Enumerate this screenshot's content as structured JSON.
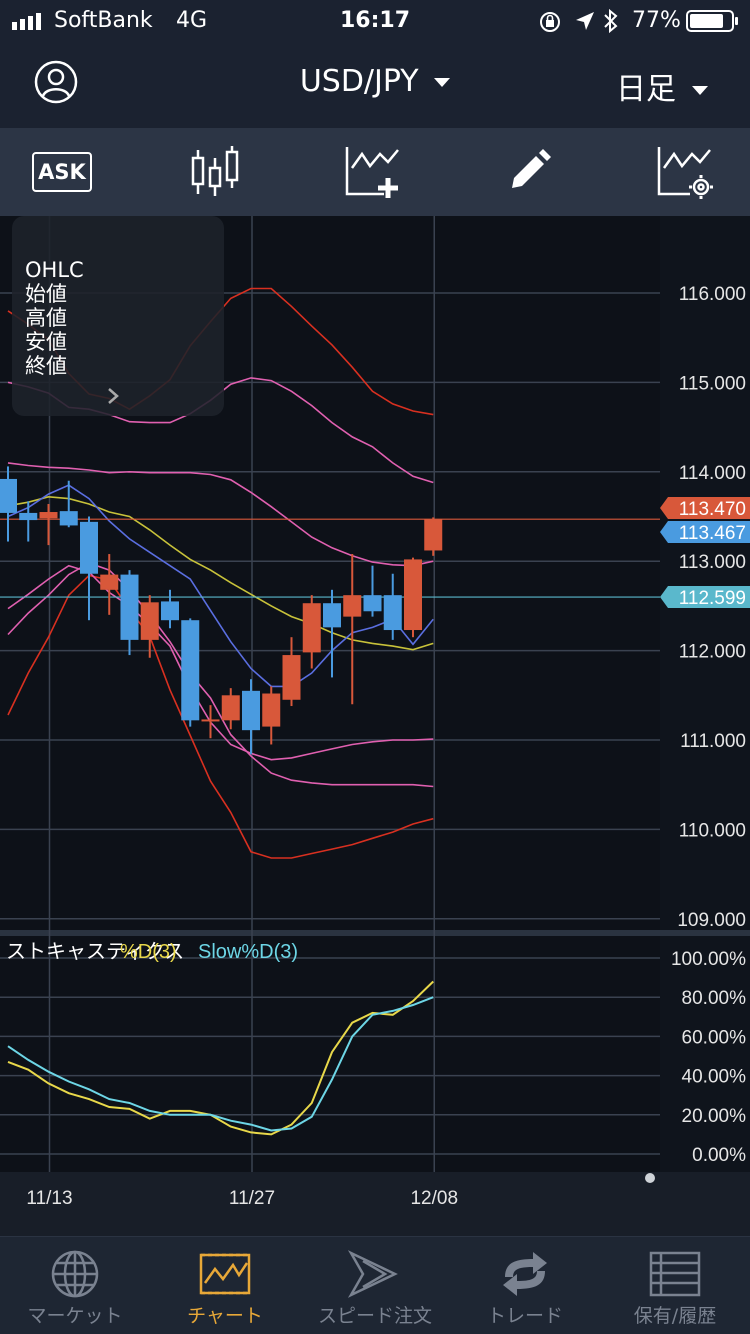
{
  "status_bar": {
    "carrier": "SoftBank",
    "network": "4G",
    "time": "16:17",
    "battery": "77%"
  },
  "header": {
    "pair": "USD/JPY",
    "timeframe": "日足"
  },
  "toolbar": {
    "ask_label": "ASK"
  },
  "ohlc_panel": {
    "title": "OHLC",
    "open": "始値",
    "high": "高値",
    "low": "安値",
    "close": "終値"
  },
  "price_axis": {
    "labels": [
      "116.000",
      "115.000",
      "114.000",
      "113.000",
      "112.000",
      "111.000",
      "110.000",
      "109.000"
    ],
    "ask_price": "113.470",
    "bid_price": "113.467",
    "line_price": "112.599"
  },
  "stoch": {
    "title": "ストキャスティクス",
    "d_label": "%D(3)",
    "slow_label": "Slow%D(3)",
    "axis_labels": [
      "100.00%",
      "80.00%",
      "60.00%",
      "40.00%",
      "20.00%",
      "0.00%"
    ]
  },
  "x_axis": {
    "labels": [
      "11/13",
      "11/27",
      "12/08"
    ]
  },
  "colors": {
    "up": "#d8583a",
    "down": "#4a9be0",
    "ma": "#c8c23a",
    "ma2": "#5a6ee0",
    "band1": "#e060b0",
    "band3": "#d83020",
    "stoch_d": "#e8d84a",
    "stoch_slow": "#6dd6e6",
    "accent": "#e8a838"
  },
  "tabs": [
    {
      "label": "マーケット",
      "icon": "globe-icon",
      "active": false
    },
    {
      "label": "チャート",
      "icon": "chart-icon",
      "active": true
    },
    {
      "label": "スピード注文",
      "icon": "speed-order-icon",
      "active": false
    },
    {
      "label": "トレード",
      "icon": "trade-icon",
      "active": false
    },
    {
      "label": "保有/履歴",
      "icon": "history-icon",
      "active": false
    }
  ],
  "chart_data": {
    "type": "line",
    "candles": [
      {
        "x": "11/08",
        "open": 113.92,
        "high": 114.06,
        "low": 113.22,
        "close": 113.54
      },
      {
        "x": "11/09",
        "open": 113.54,
        "high": 113.67,
        "low": 113.22,
        "close": 113.46
      },
      {
        "x": "11/10",
        "open": 113.48,
        "high": 113.64,
        "low": 113.18,
        "close": 113.55
      },
      {
        "x": "11/13",
        "open": 113.56,
        "high": 113.9,
        "low": 113.38,
        "close": 113.4
      },
      {
        "x": "11/14",
        "open": 113.44,
        "high": 113.5,
        "low": 112.34,
        "close": 112.86
      },
      {
        "x": "11/15",
        "open": 112.68,
        "high": 113.08,
        "low": 112.4,
        "close": 112.85
      },
      {
        "x": "11/16",
        "open": 112.85,
        "high": 112.9,
        "low": 111.95,
        "close": 112.12
      },
      {
        "x": "11/17",
        "open": 112.12,
        "high": 112.62,
        "low": 111.92,
        "close": 112.54
      },
      {
        "x": "11/20",
        "open": 112.55,
        "high": 112.68,
        "low": 112.25,
        "close": 112.34
      },
      {
        "x": "11/21",
        "open": 112.34,
        "high": 112.36,
        "low": 111.15,
        "close": 111.22
      },
      {
        "x": "11/22",
        "open": 111.22,
        "high": 111.39,
        "low": 111.02,
        "close": 111.23
      },
      {
        "x": "11/23",
        "open": 111.22,
        "high": 111.58,
        "low": 111.12,
        "close": 111.5
      },
      {
        "x": "11/24",
        "open": 111.55,
        "high": 111.68,
        "low": 110.84,
        "close": 111.11
      },
      {
        "x": "11/27",
        "open": 111.15,
        "high": 111.6,
        "low": 110.95,
        "close": 111.52
      },
      {
        "x": "11/28",
        "open": 111.45,
        "high": 112.15,
        "low": 111.38,
        "close": 111.95
      },
      {
        "x": "11/29",
        "open": 111.98,
        "high": 112.62,
        "low": 111.8,
        "close": 112.53
      },
      {
        "x": "11/30",
        "open": 112.53,
        "high": 112.68,
        "low": 111.7,
        "close": 112.26
      },
      {
        "x": "12/01",
        "open": 112.38,
        "high": 113.08,
        "low": 111.4,
        "close": 112.62
      },
      {
        "x": "12/04",
        "open": 112.62,
        "high": 112.95,
        "low": 112.38,
        "close": 112.44
      },
      {
        "x": "12/05",
        "open": 112.62,
        "high": 112.86,
        "low": 112.12,
        "close": 112.23
      },
      {
        "x": "12/06",
        "open": 112.23,
        "high": 113.04,
        "low": 112.15,
        "close": 113.02
      },
      {
        "x": "12/07",
        "open": 113.12,
        "high": 113.49,
        "low": 113.06,
        "close": 113.47
      }
    ],
    "ma": [
      113.62,
      113.66,
      113.72,
      113.7,
      113.64,
      113.55,
      113.5,
      113.35,
      113.18,
      113.02,
      112.9,
      112.76,
      112.63,
      112.5,
      112.38,
      112.3,
      112.2,
      112.12,
      112.08,
      112.05,
      112.01,
      112.08
    ],
    "ma2": [
      113.5,
      113.6,
      113.75,
      113.85,
      113.7,
      113.45,
      113.25,
      113.1,
      112.95,
      112.8,
      112.45,
      112.1,
      111.8,
      111.6,
      111.6,
      111.75,
      112.0,
      112.2,
      112.26,
      112.35,
      112.07,
      112.35
    ],
    "band_upper1": [
      114.1,
      114.07,
      114.05,
      114.04,
      114.02,
      113.99,
      114.0,
      113.99,
      113.99,
      113.99,
      113.97,
      113.91,
      113.77,
      113.61,
      113.44,
      113.27,
      113.15,
      113.06,
      112.99,
      112.96,
      112.95,
      113.0
    ],
    "band_lower1": [
      112.47,
      112.63,
      112.8,
      112.95,
      112.88,
      112.65,
      112.5,
      112.29,
      112.05,
      111.58,
      111.2,
      110.95,
      110.85,
      110.78,
      110.8,
      110.85,
      110.9,
      110.95,
      110.98,
      111.0,
      111.0,
      111.01
    ],
    "band_upper2": [
      115.0,
      114.95,
      114.88,
      114.72,
      114.7,
      114.64,
      114.56,
      114.55,
      114.55,
      114.65,
      114.8,
      114.98,
      115.05,
      115.02,
      114.9,
      114.74,
      114.55,
      114.39,
      114.28,
      114.1,
      113.95,
      113.88
    ],
    "band_lower2": [
      112.18,
      112.42,
      112.62,
      112.85,
      112.98,
      112.9,
      112.68,
      112.4,
      112.1,
      111.74,
      111.47,
      111.06,
      110.82,
      110.63,
      110.55,
      110.52,
      110.5,
      110.5,
      110.5,
      110.5,
      110.5,
      110.48
    ],
    "band_upper3": [
      115.8,
      115.65,
      115.48,
      115.1,
      114.87,
      114.82,
      114.7,
      114.85,
      115.03,
      115.41,
      115.68,
      115.94,
      116.05,
      116.05,
      115.85,
      115.63,
      115.42,
      115.17,
      114.9,
      114.76,
      114.68,
      114.64
    ],
    "band_lower3": [
      111.28,
      111.75,
      112.15,
      112.62,
      112.84,
      112.79,
      112.46,
      112.16,
      111.56,
      111.05,
      110.54,
      110.19,
      109.75,
      109.68,
      109.68,
      109.73,
      109.78,
      109.83,
      109.9,
      109.97,
      110.06,
      110.12
    ],
    "stoch_d": [
      47,
      43,
      36,
      31,
      28,
      24,
      23,
      18,
      22,
      22,
      20,
      14,
      11,
      10,
      15,
      26,
      52,
      67,
      72,
      71,
      78,
      88
    ],
    "stoch_slow": [
      55,
      48,
      42,
      37,
      33,
      28,
      26,
      22,
      20,
      20,
      20,
      17,
      15,
      12,
      13,
      19,
      38,
      60,
      71,
      73,
      76,
      80
    ],
    "xlabels": [
      "11/13",
      "11/27",
      "12/08"
    ],
    "ylim": [
      109,
      116.5
    ]
  }
}
